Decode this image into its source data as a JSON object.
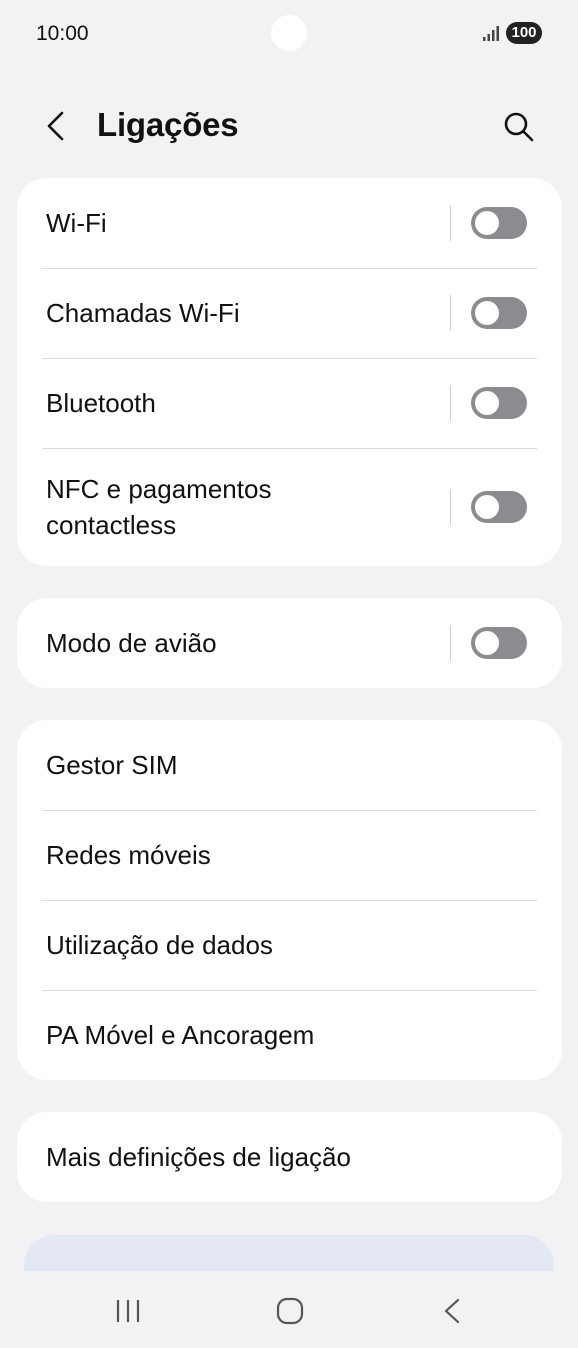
{
  "status_bar": {
    "time": "10:00",
    "battery": "100",
    "icons": [
      "signal-icon",
      "battery-icon"
    ]
  },
  "header": {
    "title": "Ligações",
    "back_icon": "back-arrow-icon",
    "search_icon": "search-icon"
  },
  "groups": [
    {
      "items": [
        {
          "label": "Wi-Fi",
          "toggle": true,
          "on": false
        },
        {
          "label": "Chamadas Wi-Fi",
          "toggle": true,
          "on": false
        },
        {
          "label": "Bluetooth",
          "toggle": true,
          "on": false
        },
        {
          "label": "NFC e pagamentos contactless",
          "toggle": true,
          "on": false
        }
      ]
    },
    {
      "items": [
        {
          "label": "Modo de avião",
          "toggle": true,
          "on": false
        }
      ]
    },
    {
      "items": [
        {
          "label": "Gestor SIM",
          "toggle": false
        },
        {
          "label": "Redes móveis",
          "toggle": false
        },
        {
          "label": "Utilização de dados",
          "toggle": false
        },
        {
          "label": "PA Móvel e Ancoragem",
          "toggle": false
        }
      ]
    },
    {
      "items": [
        {
          "label": "Mais definições de ligação",
          "toggle": false
        }
      ]
    }
  ],
  "nav_bar": {
    "icons": [
      "recents-icon",
      "home-icon",
      "back-icon"
    ]
  },
  "colors": {
    "background": "#f2f2f4",
    "card": "#ffffff",
    "toggle_off": "#8c8c90",
    "peek": "#e4e8f4"
  }
}
